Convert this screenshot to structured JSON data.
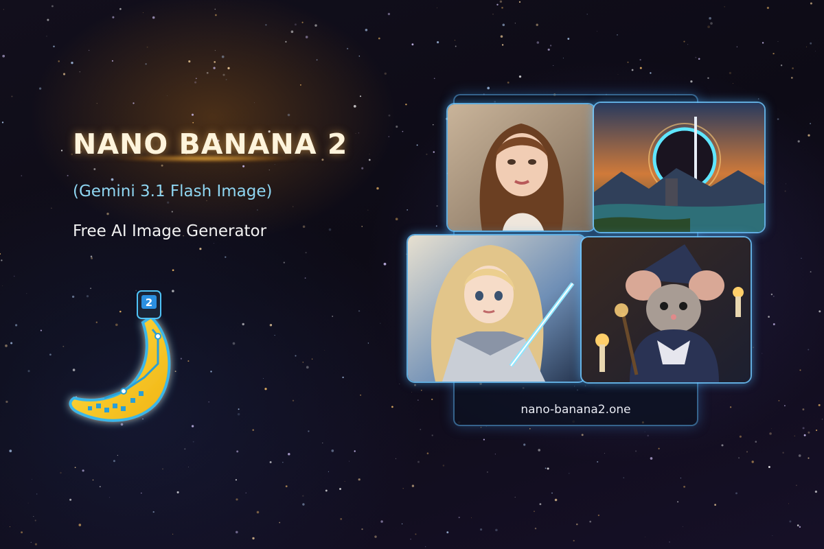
{
  "header": {
    "title": "NANO BANANA 2",
    "subtitle": "(Gemini 3.1 Flash Image)",
    "tagline": "Free AI Image Generator"
  },
  "logo": {
    "badge_number": "2"
  },
  "gallery": {
    "url": "nano-banana2.one",
    "images": [
      {
        "subject": "portrait-woman"
      },
      {
        "subject": "fantasy-landscape-eclipse"
      },
      {
        "subject": "anime-knight-girl"
      },
      {
        "subject": "wizard-mouse"
      }
    ]
  },
  "colors": {
    "title": "#fff4dc",
    "subtitle": "#8fd6f2",
    "tagline": "#f2f2f2",
    "accent_glow": "#ffb84a",
    "frame_blue": "#6ec8ff",
    "banana_yellow": "#f4c21c"
  }
}
